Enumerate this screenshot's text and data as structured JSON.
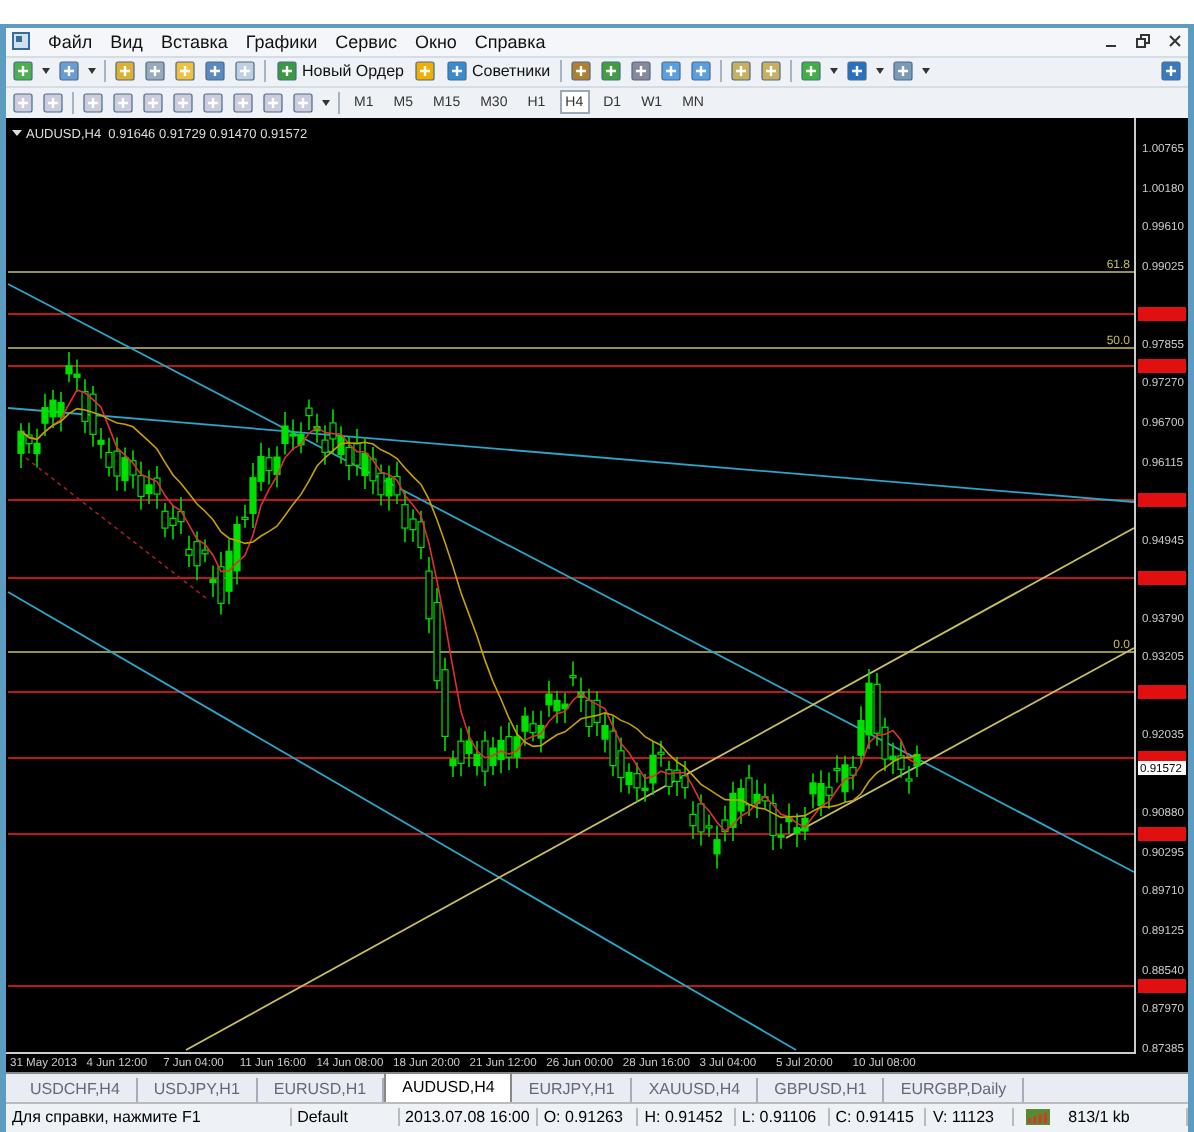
{
  "menu": [
    "Файл",
    "Вид",
    "Вставка",
    "Графики",
    "Сервис",
    "Окно",
    "Справка"
  ],
  "toolbar": {
    "new_order": "Новый Ордер",
    "experts": "Советники"
  },
  "timeframes": [
    {
      "label": "M1",
      "selected": false
    },
    {
      "label": "M5",
      "selected": false
    },
    {
      "label": "M15",
      "selected": false
    },
    {
      "label": "M30",
      "selected": false
    },
    {
      "label": "H1",
      "selected": false
    },
    {
      "label": "H4",
      "selected": true
    },
    {
      "label": "D1",
      "selected": false
    },
    {
      "label": "W1",
      "selected": false
    },
    {
      "label": "MN",
      "selected": false
    }
  ],
  "chart": {
    "header": "AUDUSD,H4  0.91646 0.91729 0.91470 0.91572",
    "fib_labels": [
      "61.8",
      "50.0",
      "0.0"
    ],
    "current_price": "0.91572",
    "price_axis": [
      "1.00765",
      "1.00180",
      "0.99610",
      "0.99025",
      "0.97855",
      "0.97270",
      "0.96700",
      "0.96115",
      "0.94945",
      "0.93790",
      "0.93205",
      "0.92035",
      "0.90880",
      "0.90295",
      "0.89710",
      "0.89125",
      "0.88540",
      "0.87970",
      "0.87385"
    ],
    "time_axis": [
      "31 May 2013",
      "4 Jun 12:00",
      "7 Jun 04:00",
      "11 Jun 16:00",
      "14 Jun 08:00",
      "18 Jun 20:00",
      "21 Jun 12:00",
      "26 Jun 00:00",
      "28 Jun 16:00",
      "3 Jul 04:00",
      "5 Jul 20:00",
      "10 Jul 08:00"
    ]
  },
  "tabs": [
    {
      "label": "USDCHF,H4",
      "selected": false
    },
    {
      "label": "USDJPY,H1",
      "selected": false
    },
    {
      "label": "EURUSD,H1",
      "selected": false
    },
    {
      "label": "AUDUSD,H4",
      "selected": true
    },
    {
      "label": "EURJPY,H1",
      "selected": false
    },
    {
      "label": "XAUUSD,H4",
      "selected": false
    },
    {
      "label": "GBPUSD,H1",
      "selected": false
    },
    {
      "label": "EURGBP,Daily",
      "selected": false
    }
  ],
  "status": [
    "Для справки, нажмите F1",
    "Default",
    "2013.07.08 16:00",
    "O: 0.91263",
    "H: 0.91452",
    "L: 0.91106",
    "C: 0.91415",
    "V: 11123",
    "813/1 kb"
  ]
}
